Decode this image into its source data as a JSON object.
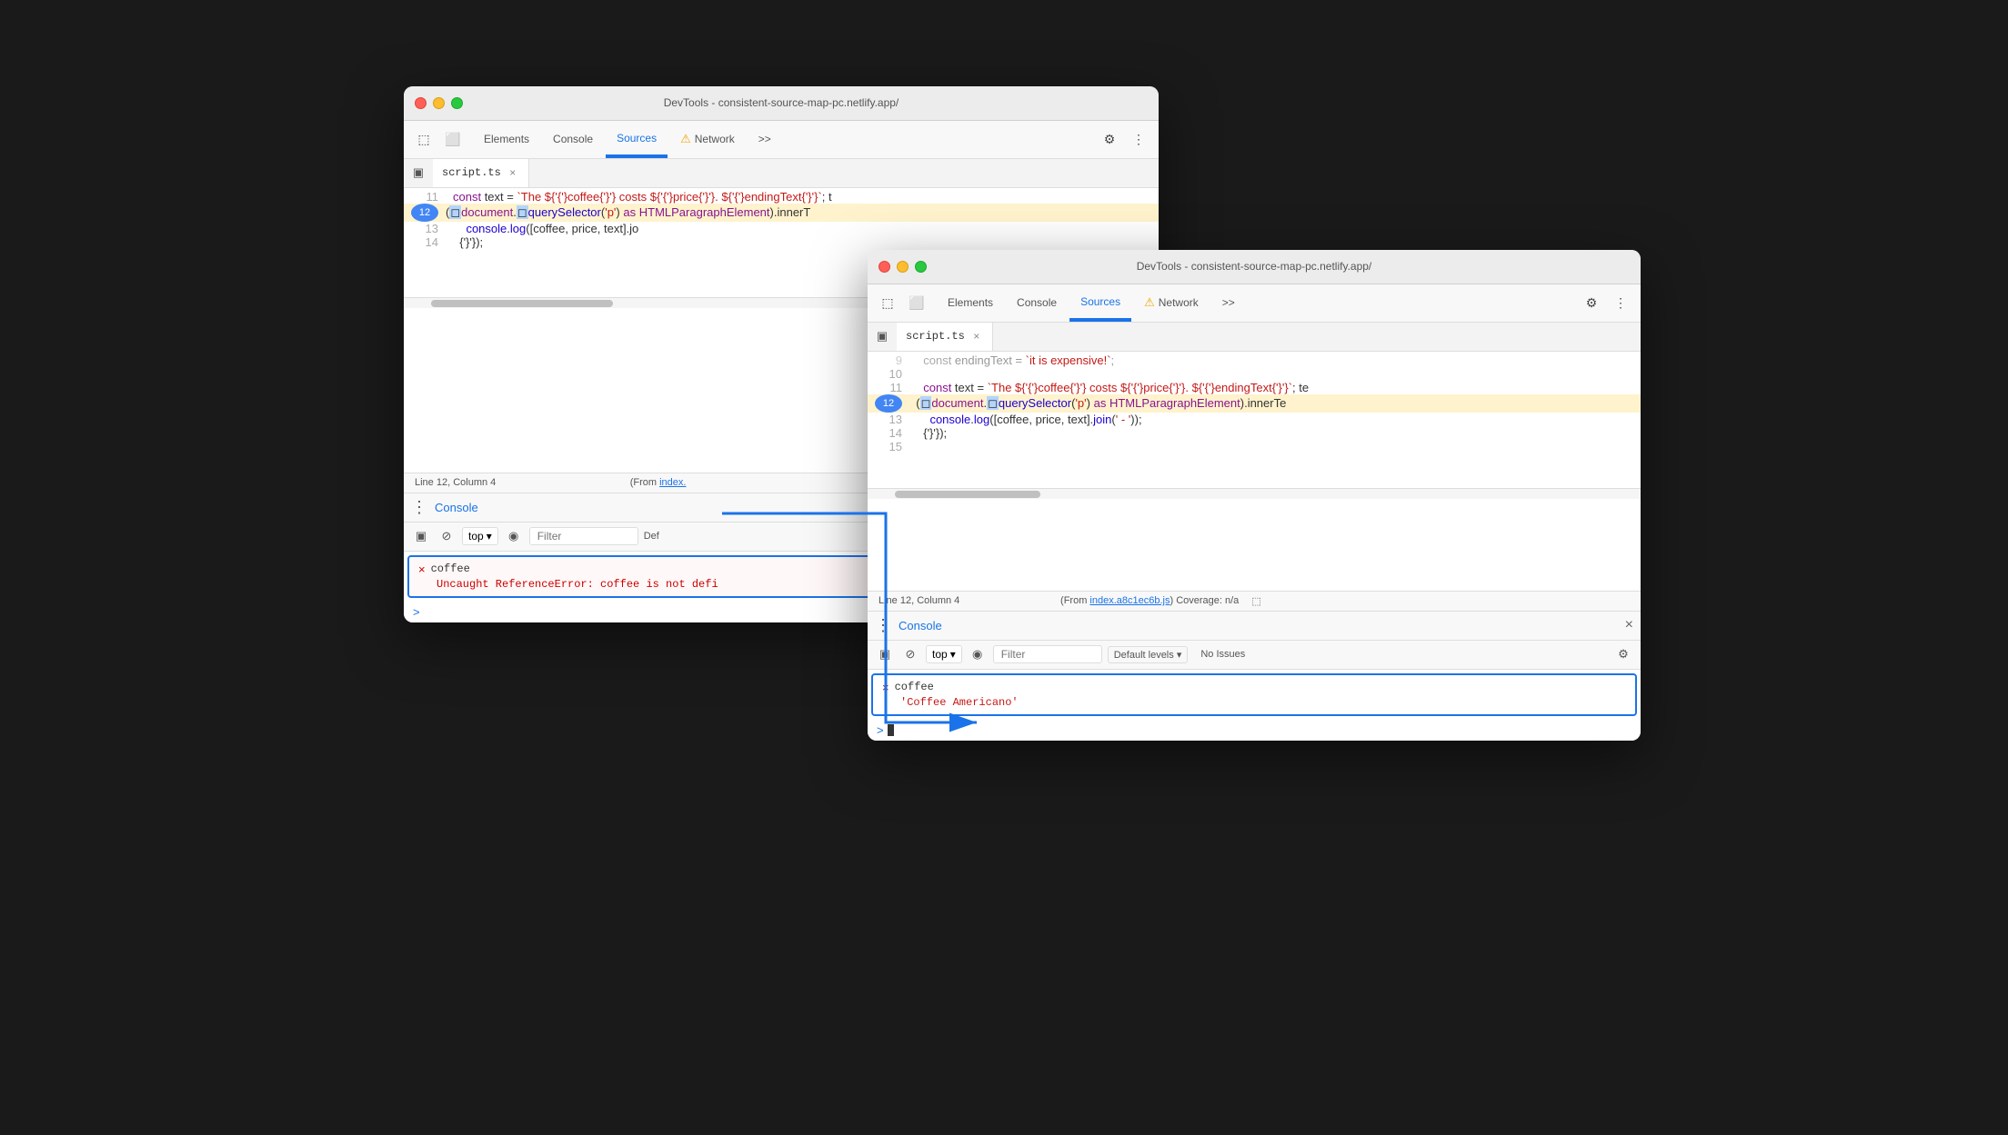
{
  "scene": {
    "background": "#1a1a1a"
  },
  "window_back": {
    "title": "DevTools - consistent-source-map-pc.netlify.app/",
    "tabs": {
      "elements": "Elements",
      "console_tab": "Console",
      "sources": "Sources",
      "network": "Network",
      "more": ">>"
    },
    "file_tab": {
      "name": "script.ts",
      "close": "×"
    },
    "code_lines": [
      {
        "num": "11",
        "content": "const text = `The ${coffee} costs ${price}. ${endingText}`;  t"
      },
      {
        "num": "12",
        "content": "(document.querySelector('p') as HTMLParagraphElement).innerT",
        "highlighted": true
      },
      {
        "num": "13",
        "content": "    console.log([coffee, price, text].jo"
      },
      {
        "num": "14",
        "content": "  });"
      }
    ],
    "status_bar": {
      "position": "Line 12, Column 4",
      "from_text": "(From index.",
      "link_text": "index.",
      "suffix": ")"
    },
    "console_panel": {
      "title": "Console",
      "entry_x": "×",
      "entry_name": "coffee",
      "entry_error": "Uncaught ReferenceError: coffee is not defi",
      "prompt_arrow": ">"
    },
    "console_toolbar": {
      "top_label": "top",
      "filter_placeholder": "Filter",
      "default_label": "Def"
    }
  },
  "window_front": {
    "title": "DevTools - consistent-source-map-pc.netlify.app/",
    "tabs": {
      "elements": "Elements",
      "console_tab": "Console",
      "sources": "Sources",
      "network": "Network",
      "more": ">>"
    },
    "file_tab": {
      "name": "script.ts",
      "close": "×"
    },
    "code_lines": [
      {
        "num": "9",
        "content": "  const endingText = `it is expensive!`;",
        "gray": true
      },
      {
        "num": "10",
        "content": ""
      },
      {
        "num": "11",
        "content": "  const text = `The ${coffee} costs ${price}. ${endingText}`;  te"
      },
      {
        "num": "12",
        "content": "  (document.querySelector('p') as HTMLParagraphElement).innerTe",
        "highlighted": true
      },
      {
        "num": "13",
        "content": "    console.log([coffee, price, text].join(' - '));"
      },
      {
        "num": "14",
        "content": "  });"
      },
      {
        "num": "15",
        "content": ""
      }
    ],
    "status_bar": {
      "position": "Line 12, Column 4",
      "from_text": "(From ",
      "link_text": "index.a8c1ec6b.js",
      "coverage": ") Coverage: n/a"
    },
    "console_panel": {
      "title": "Console",
      "close": "×",
      "entry_x": "×",
      "entry_name": "coffee",
      "entry_success": "'Coffee Americano'",
      "prompt_arrow": ">"
    },
    "console_toolbar": {
      "top_label": "top",
      "filter_placeholder": "Filter",
      "default_label": "Default levels",
      "no_issues": "No Issues"
    }
  },
  "icons": {
    "inspect": "⬚",
    "device": "⬜",
    "toggle_panel": "▣",
    "block": "⊘",
    "eye": "◉",
    "chevron_down": "▾",
    "gear": "⚙",
    "more_vert": "⋮",
    "warning": "⚠",
    "close": "×",
    "dots": "⋮",
    "arrow_right": "▶",
    "settings": "⚙"
  }
}
